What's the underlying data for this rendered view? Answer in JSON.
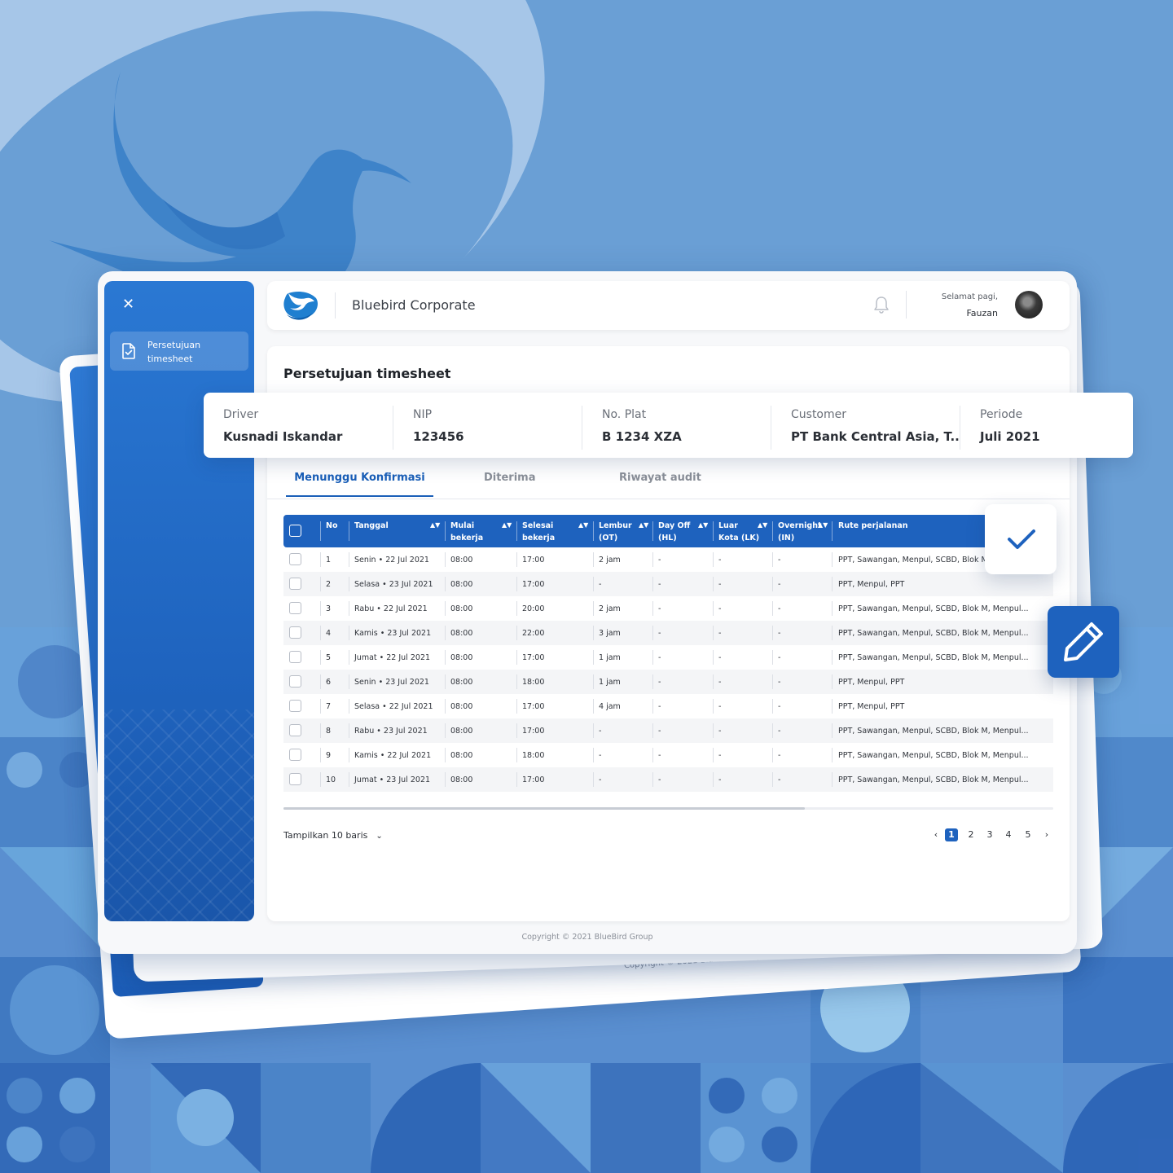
{
  "app": {
    "title": "Bluebird Corporate"
  },
  "header": {
    "greeting": "Selamat pagi,",
    "user_name": "Fauzan"
  },
  "sidebar": {
    "items": [
      {
        "label": "Persetujuan timesheet",
        "icon": "document-check-icon"
      }
    ]
  },
  "page": {
    "title": "Persetujuan timesheet"
  },
  "info": {
    "driver_label": "Driver",
    "driver_value": "Kusnadi Iskandar",
    "nip_label": "NIP",
    "nip_value": "123456",
    "plat_label": "No. Plat",
    "plat_value": "B 1234 XZA",
    "customer_label": "Customer",
    "customer_value": "PT Bank Central Asia, T..",
    "periode_label": "Periode",
    "periode_value": "Juli 2021"
  },
  "tabs": [
    {
      "label": "Menunggu Konfirmasi",
      "active": true
    },
    {
      "label": "Diterima",
      "active": false
    },
    {
      "label": "Riwayat audit",
      "active": false
    }
  ],
  "table": {
    "columns": {
      "no": "No",
      "tanggal": "Tanggal",
      "mulai_1": "Mulai",
      "mulai_2": "bekerja",
      "selesai_1": "Selesai",
      "selesai_2": "bekerja",
      "lembur_1": "Lembur",
      "lembur_2": "(OT)",
      "dayoff_1": "Day Off",
      "dayoff_2": "(HL)",
      "luar_1": "Luar",
      "luar_2": "Kota (LK)",
      "overnight_1": "Overnight",
      "overnight_2": "(IN)",
      "rute": "Rute perjalanan"
    },
    "rows": [
      {
        "no": "1",
        "tanggal": "Senin • 22 Jul 2021",
        "mulai": "08:00",
        "selesai": "17:00",
        "lembur": "2 jam",
        "dayoff": "-",
        "luar": "-",
        "overnight": "-",
        "rute": "PPT, Sawangan, Menpul, SCBD, Blok M, M"
      },
      {
        "no": "2",
        "tanggal": "Selasa • 23 Jul 2021",
        "mulai": "08:00",
        "selesai": "17:00",
        "lembur": "-",
        "dayoff": "-",
        "luar": "-",
        "overnight": "-",
        "rute": "PPT, Menpul, PPT"
      },
      {
        "no": "3",
        "tanggal": "Rabu • 22 Jul 2021",
        "mulai": "08:00",
        "selesai": "20:00",
        "lembur": "2 jam",
        "dayoff": "-",
        "luar": "-",
        "overnight": "-",
        "rute": "PPT, Sawangan, Menpul, SCBD, Blok M, Menpul..."
      },
      {
        "no": "4",
        "tanggal": "Kamis • 23 Jul 2021",
        "mulai": "08:00",
        "selesai": "22:00",
        "lembur": "3 jam",
        "dayoff": "-",
        "luar": "-",
        "overnight": "-",
        "rute": "PPT, Sawangan, Menpul, SCBD, Blok M, Menpul..."
      },
      {
        "no": "5",
        "tanggal": "Jumat • 22 Jul 2021",
        "mulai": "08:00",
        "selesai": "17:00",
        "lembur": "1 jam",
        "dayoff": "-",
        "luar": "-",
        "overnight": "-",
        "rute": "PPT, Sawangan, Menpul, SCBD, Blok M, Menpul..."
      },
      {
        "no": "6",
        "tanggal": "Senin • 23 Jul 2021",
        "mulai": "08:00",
        "selesai": "18:00",
        "lembur": "1 jam",
        "dayoff": "-",
        "luar": "-",
        "overnight": "-",
        "rute": "PPT, Menpul, PPT"
      },
      {
        "no": "7",
        "tanggal": "Selasa • 22 Jul 2021",
        "mulai": "08:00",
        "selesai": "17:00",
        "lembur": "4 jam",
        "dayoff": "-",
        "luar": "-",
        "overnight": "-",
        "rute": "PPT, Menpul, PPT"
      },
      {
        "no": "8",
        "tanggal": "Rabu • 23 Jul 2021",
        "mulai": "08:00",
        "selesai": "17:00",
        "lembur": "-",
        "dayoff": "-",
        "luar": "-",
        "overnight": "-",
        "rute": "PPT, Sawangan, Menpul, SCBD, Blok M, Menpul..."
      },
      {
        "no": "9",
        "tanggal": "Kamis • 22 Jul 2021",
        "mulai": "08:00",
        "selesai": "18:00",
        "lembur": "-",
        "dayoff": "-",
        "luar": "-",
        "overnight": "-",
        "rute": "PPT, Sawangan, Menpul, SCBD, Blok M, Menpul..."
      },
      {
        "no": "10",
        "tanggal": "Jumat • 23 Jul 2021",
        "mulai": "08:00",
        "selesai": "17:00",
        "lembur": "-",
        "dayoff": "-",
        "luar": "-",
        "overnight": "-",
        "rute": "PPT, Sawangan, Menpul, SCBD, Blok M, Menpul..."
      }
    ]
  },
  "footer": {
    "rows_label": "Tampilkan 10 baris",
    "pages": [
      "1",
      "2",
      "3",
      "4",
      "5"
    ],
    "current_page": "1",
    "prev": "‹",
    "next": "›",
    "copyright": "Copyright © 2021 BlueBird Group"
  },
  "colors": {
    "primary": "#1e62be",
    "background": "#6a9fd5"
  }
}
